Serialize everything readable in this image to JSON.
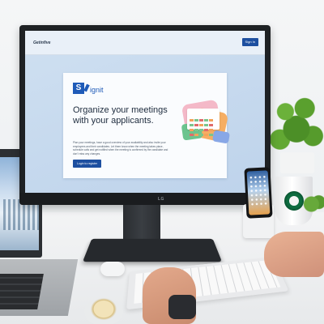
{
  "screen": {
    "site_logo": "Getinfive",
    "signin_label": "Sign In",
    "product_logo_letter": "S",
    "product_name": "ignit",
    "headline": "Organize your meetings with your applicants.",
    "description": "Plan your meetings, have a good overview of your availability and also invite your employees and their candidates. Let them know when the meeting takes place, schedule calls and get notified when the meeting is confirmed by the candidate and don't miss any changes.",
    "login_label": "Login to register"
  },
  "monitor": {
    "brand": "LG"
  },
  "colors": {
    "accent": "#1d4fa0",
    "screen_bg": "#c7dbef"
  }
}
